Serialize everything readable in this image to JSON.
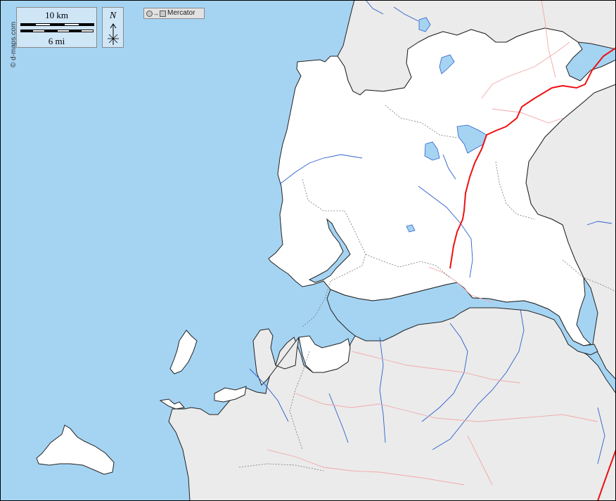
{
  "map": {
    "credit": "© d-maps.com",
    "scale": {
      "km_label": "10 km",
      "mi_label": "6 mi"
    },
    "north_label": "N",
    "projection_label": "Mercator",
    "colors": {
      "water": "#a5d4f3",
      "highlighted_land": "#ffffff",
      "other_land": "#ebebeb",
      "rivers": "#2b5fcc",
      "roads": "#f2a9a9",
      "main_road": "#ee1111",
      "boundaries": "#777777"
    }
  }
}
